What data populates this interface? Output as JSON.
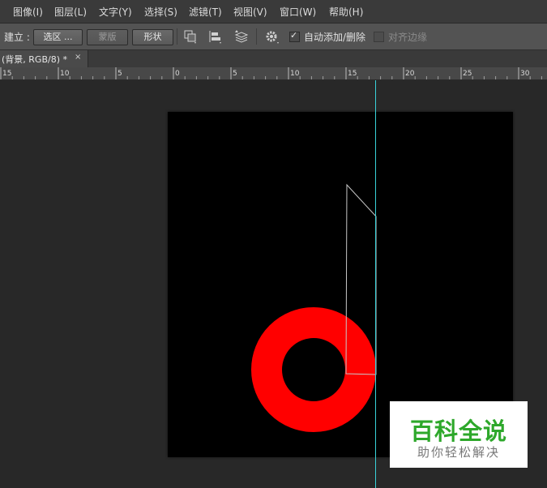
{
  "menubar": {
    "items": [
      "图像(I)",
      "图层(L)",
      "文字(Y)",
      "选择(S)",
      "滤镜(T)",
      "视图(V)",
      "窗口(W)",
      "帮助(H)"
    ]
  },
  "options": {
    "make_label": "建立 :",
    "selection_button": "选区 ...",
    "mask_button": "蒙版",
    "shape_button": "形状",
    "auto_add_delete": {
      "label": "自动添加/删除",
      "checked": true
    },
    "align_edges": {
      "label": "对齐边缘",
      "checked": false,
      "enabled": false
    }
  },
  "document_tab": {
    "title": "(背景, RGB/8) *",
    "close": "×"
  },
  "ruler": {
    "labels": [
      "15",
      "10",
      "5",
      "0",
      "5",
      "10",
      "15",
      "20",
      "25",
      "30"
    ]
  },
  "watermark": {
    "title": "百科全说",
    "subtitle": "助你轻松解决"
  },
  "colors": {
    "canvas": "#000000",
    "ring": "#ff0000",
    "guide": "#39d2d9",
    "path": "#c8c8c8",
    "watermark_text": "#2ea82b"
  }
}
